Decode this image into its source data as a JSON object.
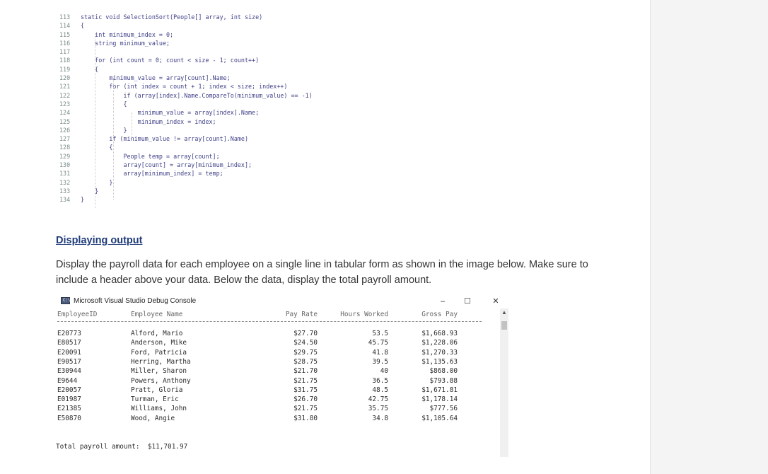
{
  "code": {
    "lines": [
      {
        "num": "113",
        "text": "static void SelectionSort(People[] array, int size)"
      },
      {
        "num": "114",
        "text": "{"
      },
      {
        "num": "115",
        "text": "    int minimum_index = 0;"
      },
      {
        "num": "116",
        "text": "    string minimum_value;"
      },
      {
        "num": "117",
        "text": ""
      },
      {
        "num": "118",
        "text": "    for (int count = 0; count < size - 1; count++)"
      },
      {
        "num": "119",
        "text": "    {"
      },
      {
        "num": "120",
        "text": "        minimum_value = array[count].Name;"
      },
      {
        "num": "121",
        "text": "        for (int index = count + 1; index < size; index++)"
      },
      {
        "num": "122",
        "text": "            if (array[index].Name.CompareTo(minimum_value) == -1)"
      },
      {
        "num": "123",
        "text": "            {"
      },
      {
        "num": "124",
        "text": "                minimum_value = array[index].Name;"
      },
      {
        "num": "125",
        "text": "                minimum_index = index;"
      },
      {
        "num": "126",
        "text": "            }"
      },
      {
        "num": "127",
        "text": "        if (minimum_value != array[count].Name)"
      },
      {
        "num": "128",
        "text": "        {"
      },
      {
        "num": "129",
        "text": "            People temp = array[count];"
      },
      {
        "num": "130",
        "text": "            array[count] = array[minimum_index];"
      },
      {
        "num": "131",
        "text": "            array[minimum_index] = temp;"
      },
      {
        "num": "132",
        "text": "        }"
      },
      {
        "num": "133",
        "text": "    }"
      },
      {
        "num": "134",
        "text": "}"
      }
    ]
  },
  "section": {
    "heading": "Displaying output",
    "text": "Display the payroll data for each employee on a single line in tabular form as shown in the image below. Make sure to include a header above your data. Below the data, display the total payroll amount."
  },
  "console": {
    "icon_label": "C:\\",
    "icon": "console-app-icon",
    "title": "Microsoft Visual Studio Debug Console",
    "minimize": "–",
    "maximize": "☐",
    "close": "✕",
    "scroll_up": "▲",
    "headers": {
      "id": "EmployeeID",
      "name": "Employee Name",
      "rate": "Pay Rate",
      "hours": "Hours Worked",
      "gross": "Gross Pay"
    },
    "rows": [
      {
        "id": "E20773",
        "name": "Alford, Mario",
        "rate": "$27.70",
        "hours": "53.5",
        "gross": "$1,668.93"
      },
      {
        "id": "E80517",
        "name": "Anderson, Mike",
        "rate": "$24.50",
        "hours": "45.75",
        "gross": "$1,228.06"
      },
      {
        "id": "E20091",
        "name": "Ford, Patricia",
        "rate": "$29.75",
        "hours": "41.8",
        "gross": "$1,270.33"
      },
      {
        "id": "E90517",
        "name": "Herring, Martha",
        "rate": "$28.75",
        "hours": "39.5",
        "gross": "$1,135.63"
      },
      {
        "id": "E30944",
        "name": "Miller, Sharon",
        "rate": "$21.70",
        "hours": "40",
        "gross": "$868.00"
      },
      {
        "id": "E9644",
        "name": "Powers, Anthony",
        "rate": "$21.75",
        "hours": "36.5",
        "gross": "$793.88"
      },
      {
        "id": "E20057",
        "name": "Pratt, Gloria",
        "rate": "$31.75",
        "hours": "48.5",
        "gross": "$1,671.81"
      },
      {
        "id": "E01987",
        "name": "Turman, Eric",
        "rate": "$26.70",
        "hours": "42.75",
        "gross": "$1,178.14"
      },
      {
        "id": "E21385",
        "name": "Williams, John",
        "rate": "$21.75",
        "hours": "35.75",
        "gross": "$777.56"
      },
      {
        "id": "E50870",
        "name": "Wood, Angie",
        "rate": "$31.80",
        "hours": "34.8",
        "gross": "$1,105.64"
      }
    ],
    "total_label": "Total payroll amount:",
    "total_value": "$11,701.97"
  }
}
